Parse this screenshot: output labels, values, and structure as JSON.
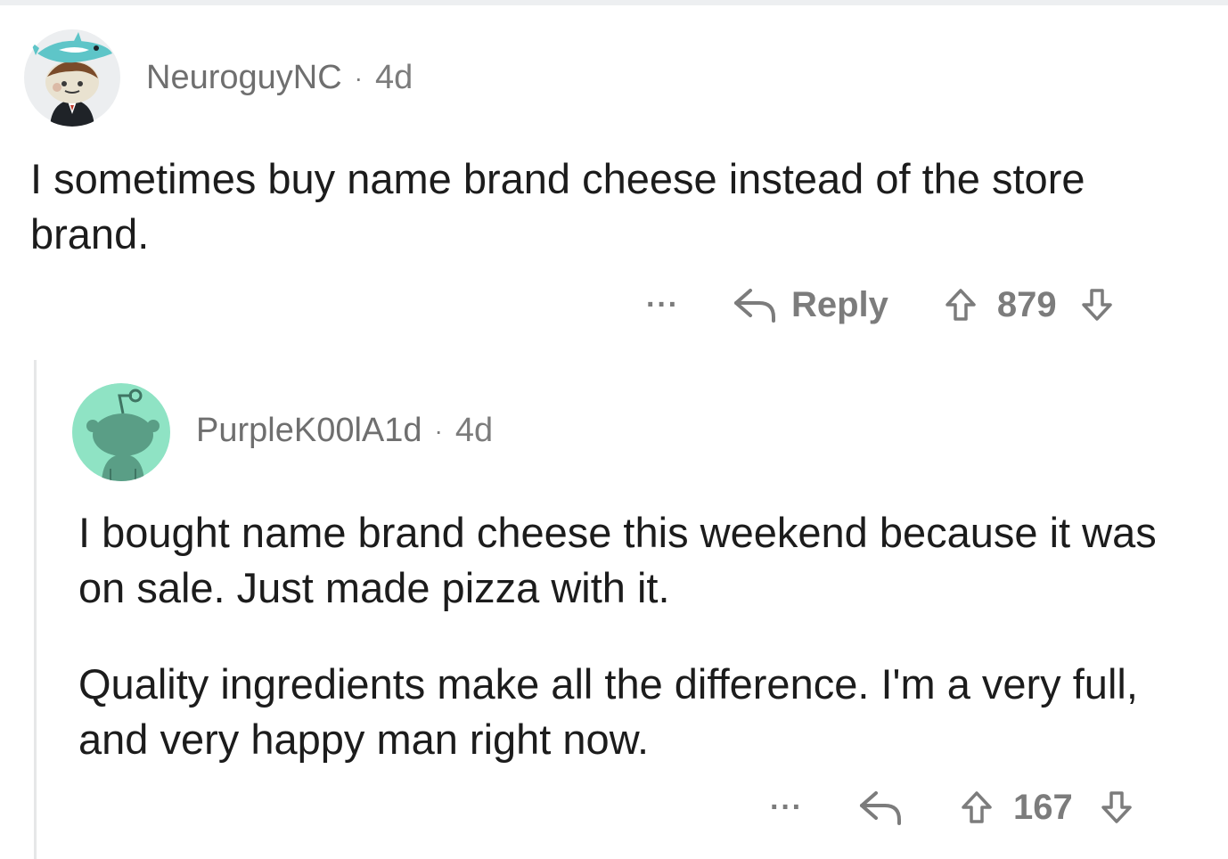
{
  "comments": [
    {
      "username": "NeuroguyNC",
      "separator": "·",
      "age": "4d",
      "paragraphs": [
        "I sometimes buy name brand cheese instead of the store brand."
      ],
      "actions": {
        "more_label": "···",
        "reply_label": "Reply",
        "score": "879"
      }
    },
    {
      "username": "PurpleK00lA1d",
      "separator": "·",
      "age": "4d",
      "paragraphs": [
        "I bought name brand cheese this weekend because it was on sale. Just made pizza with it.",
        "Quality ingredients make all the difference. I'm a very full, and very happy man right now."
      ],
      "actions": {
        "more_label": "···",
        "score": "167"
      }
    }
  ],
  "colors": {
    "meta_gray": "#7c7c7c",
    "thread_line": "#e6e7e8",
    "avatar2_bg": "#8fe3c4"
  },
  "icons": [
    "reply-arrow-icon",
    "upvote-arrow-icon",
    "downvote-arrow-icon",
    "more-options-icon"
  ]
}
